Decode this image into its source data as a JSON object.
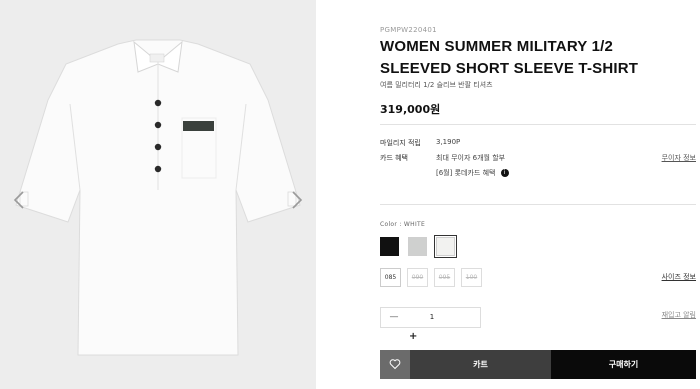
{
  "product": {
    "sku": "PGMPW220401",
    "title": "WOMEN SUMMER MILITARY 1/2 SLEEVED SHORT SLEEVE T-SHIRT",
    "subtitle": "여름 밀리터리 1/2 슬리브 반팔 티셔츠",
    "price": "319,000원"
  },
  "benefits": {
    "mileage_label": "마일리지 적립",
    "mileage_value": "3,190P",
    "card_label": "카드 혜택",
    "card_value": "최대 무이자 6개월 할부",
    "card_extra": "[6월] 롯데카드 혜택",
    "card_info_icon": "i",
    "installment_link": "무이자 정보"
  },
  "options": {
    "color_label": "Color : WHITE",
    "colors": [
      {
        "name": "black",
        "hex": "#111111"
      },
      {
        "name": "gray",
        "hex": "#cfd0cf"
      },
      {
        "name": "white",
        "hex": "#f2f2f0"
      }
    ],
    "selected_color": "white",
    "sizes": [
      {
        "label": "085",
        "available": true
      },
      {
        "label": "090",
        "available": false
      },
      {
        "label": "095",
        "available": false
      },
      {
        "label": "100",
        "available": false
      }
    ],
    "size_guide": "사이즈 정보",
    "restock_link": "재입고 알림"
  },
  "quantity": {
    "minus": "—",
    "value": "1",
    "plus": "+"
  },
  "actions": {
    "cart_label": "카트",
    "buy_label": "구매하기"
  },
  "icons": {
    "prev": "chevron-left-icon",
    "next": "chevron-right-icon",
    "wishlist": "heart-icon"
  }
}
